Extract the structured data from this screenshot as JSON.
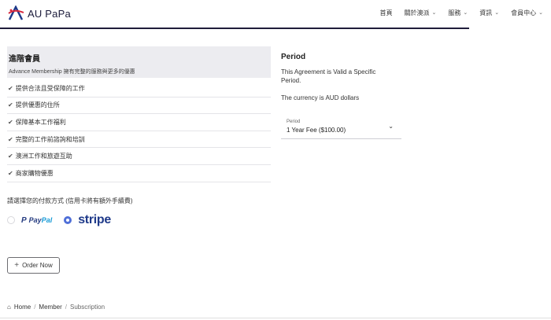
{
  "header": {
    "brand": "AU PaPa",
    "nav": [
      {
        "label": "首頁",
        "has_dropdown": false
      },
      {
        "label": "關於澳派",
        "has_dropdown": true
      },
      {
        "label": "服務",
        "has_dropdown": true
      },
      {
        "label": "資訊",
        "has_dropdown": true
      },
      {
        "label": "會員中心",
        "has_dropdown": true
      }
    ]
  },
  "membership": {
    "title": "進階會員",
    "subtitle": "Advance Membership 擁有完整的服務與更多的優惠",
    "features": [
      "提供合法且受保障的工作",
      "提供優惠的住所",
      "保障基本工作福利",
      "完整的工作前諮詢和培訓",
      "澳洲工作和旅遊互助",
      "商家購物優惠"
    ]
  },
  "payment": {
    "label": "請選擇您的付款方式 (信用卡將有額外手續費)",
    "paypal_part1": "Pay",
    "paypal_part2": "Pal",
    "stripe": "stripe",
    "selected": "stripe"
  },
  "order_button": "Order Now",
  "breadcrumb": {
    "home": "Home",
    "member": "Member",
    "current": "Subscription",
    "separator": "/"
  },
  "period": {
    "title": "Period",
    "description": "This Agreement is Valid a Specific Period.",
    "currency_note": "The currency is AUD dollars",
    "select_label": "Period",
    "select_value": "1 Year Fee ($100.00)"
  },
  "icons": {
    "chevron": "⌄",
    "check": "✔",
    "plus": "+",
    "home": "⌂"
  },
  "colors": {
    "header_line": "#1f1c3a",
    "card_bg": "#ececf0",
    "stripe": "#1f3a8a",
    "paypal_dark": "#253b80",
    "paypal_light": "#179bd7",
    "radio_selected": "#4f6fd8"
  }
}
